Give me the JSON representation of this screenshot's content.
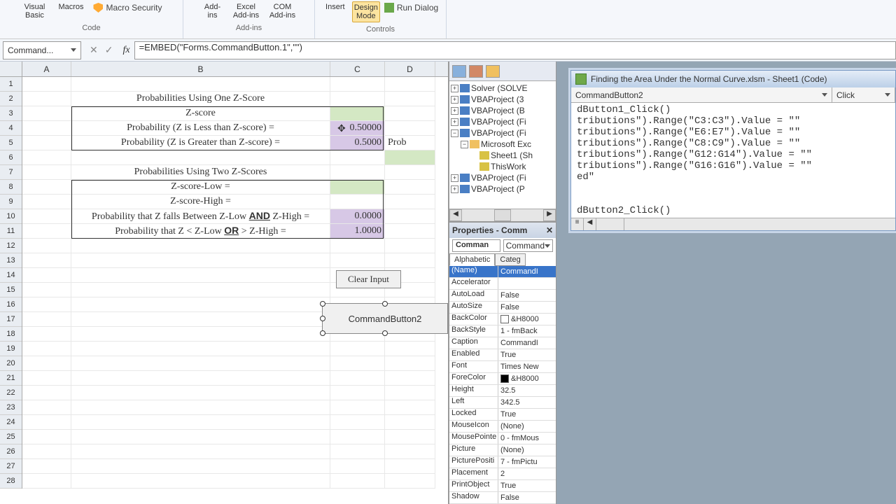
{
  "ribbon": {
    "groups": {
      "code": {
        "visual_basic": "Visual Basic",
        "macros": "Macros",
        "macro_security": "Macro Security",
        "label": "Code"
      },
      "addins": {
        "addins": "Add-ins",
        "excel_addins": "Excel Add-ins",
        "com_addins": "COM Add-ins",
        "label": "Add-ins"
      },
      "controls": {
        "insert": "Insert",
        "design_mode": "Design Mode",
        "run_dialog": "Run Dialog",
        "label": "Controls"
      }
    }
  },
  "namebox": {
    "value": "Command..."
  },
  "formula": {
    "value": "=EMBED(\"Forms.CommandButton.1\",\"\")"
  },
  "columns": [
    "A",
    "B",
    "C",
    "D"
  ],
  "sheet": {
    "title1": "Probabilities Using One Z-Score",
    "r3_b": "Z-score",
    "r4_b": "Probability (Z is Less than Z-score) =",
    "r4_c": "0.50000",
    "r5_b": "Probability (Z is Greater than Z-score) =",
    "r5_c": "0.5000",
    "r5_d": "Prob",
    "title2": "Probabilities Using Two Z-Scores",
    "r8_b": "Z-score-Low =",
    "r9_b": "Z-score-High =",
    "r10_b_pre": "Probability that Z falls Between Z-Low ",
    "r10_b_and": "AND",
    "r10_b_post": " Z-High =",
    "r10_c": "0.0000",
    "r11_b_pre": "Probability that Z < Z-Low ",
    "r11_b_or": "OR",
    "r11_b_post": " > Z-High =",
    "r11_c": "1.0000",
    "clear_btn": "Clear Input",
    "cmd_btn": "CommandButton2"
  },
  "project": {
    "items": [
      "Solver (SOLVE",
      "VBAProject (3",
      "VBAProject (B",
      "VBAProject (Fi",
      "VBAProject (Fi"
    ],
    "open_item": "Microsoft Exc",
    "sheet1": "Sheet1 (Sh",
    "thiswb": "ThisWork",
    "items2": [
      "VBAProject (Fi",
      "VBAProject (P"
    ]
  },
  "properties": {
    "title": "Properties - Comm",
    "obj_name": "Comman",
    "obj_type": "Command",
    "tabs": {
      "alpha": "Alphabetic",
      "cat": "Categ"
    },
    "rows": [
      {
        "name": "(Name)",
        "val": "CommandI",
        "sel": true
      },
      {
        "name": "Accelerator",
        "val": ""
      },
      {
        "name": "AutoLoad",
        "val": "False"
      },
      {
        "name": "AutoSize",
        "val": "False"
      },
      {
        "name": "BackColor",
        "val": "&H8000",
        "swatch": "#ffffff"
      },
      {
        "name": "BackStyle",
        "val": "1 - fmBack"
      },
      {
        "name": "Caption",
        "val": "CommandI"
      },
      {
        "name": "Enabled",
        "val": "True"
      },
      {
        "name": "Font",
        "val": "Times New"
      },
      {
        "name": "ForeColor",
        "val": "&H8000",
        "swatch": "#000000"
      },
      {
        "name": "Height",
        "val": "32.5"
      },
      {
        "name": "Left",
        "val": "342.5"
      },
      {
        "name": "Locked",
        "val": "True"
      },
      {
        "name": "MouseIcon",
        "val": "(None)"
      },
      {
        "name": "MousePointe",
        "val": "0 - fmMous"
      },
      {
        "name": "Picture",
        "val": "(None)"
      },
      {
        "name": "PicturePositi",
        "val": "7 - fmPictu"
      },
      {
        "name": "Placement",
        "val": "2"
      },
      {
        "name": "PrintObject",
        "val": "True"
      },
      {
        "name": "Shadow",
        "val": "False"
      }
    ]
  },
  "code": {
    "title": "Finding the Area Under the Normal Curve.xlsm - Sheet1 (Code)",
    "left_sel": "CommandButton2",
    "right_sel": "Click",
    "lines": [
      "dButton1_Click()",
      "tributions\").Range(\"C3:C3\").Value = \"\"",
      "tributions\").Range(\"E6:E7\").Value = \"\"",
      "tributions\").Range(\"C8:C9\").Value = \"\"",
      "tributions\").Range(\"G12:G14\").Value = \"\"",
      "tributions\").Range(\"G16:G16\").Value = \"\"",
      "ed\"",
      "",
      "",
      "dButton2_Click()"
    ]
  }
}
